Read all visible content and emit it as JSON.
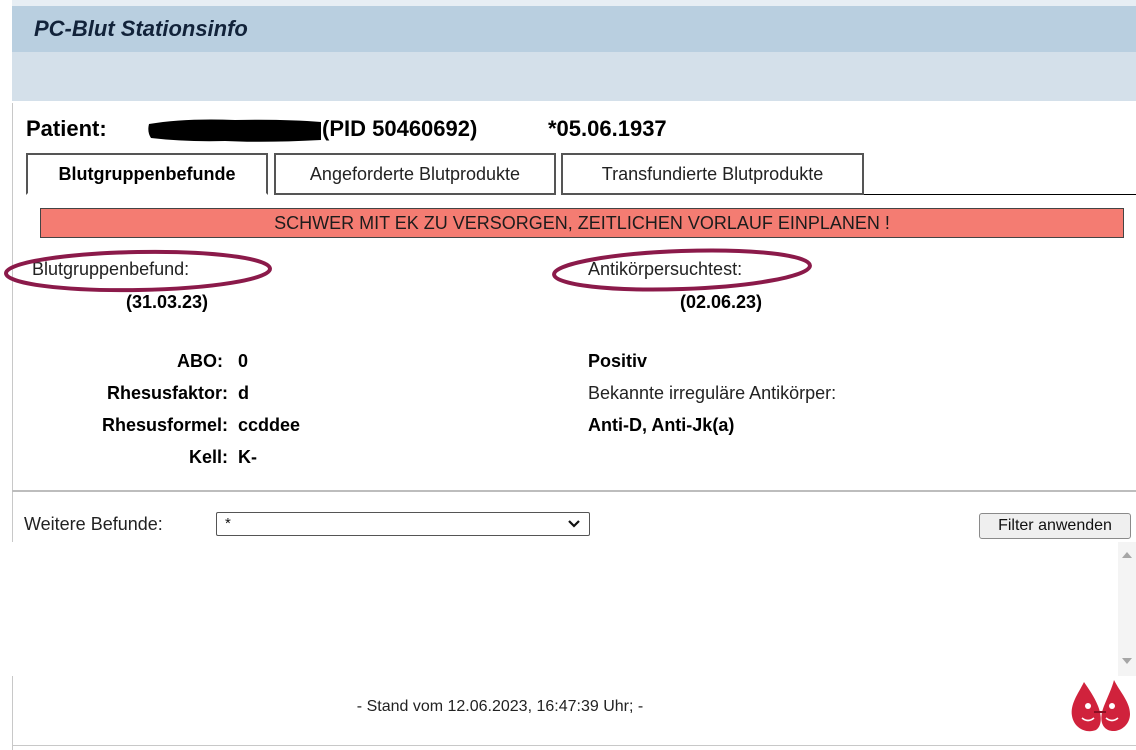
{
  "app": {
    "title": "PC-Blut Stationsinfo"
  },
  "patient": {
    "label": "Patient:",
    "pid": "(PID 50460692)",
    "birth_date": "*05.06.1937"
  },
  "tabs": [
    {
      "label": "Blutgruppenbefunde",
      "active": true
    },
    {
      "label": "Angeforderte Blutprodukte",
      "active": false
    },
    {
      "label": "Transfundierte Blutprodukte",
      "active": false
    }
  ],
  "warning": {
    "text": "SCHWER MIT EK ZU VERSORGEN, ZEITLICHEN VORLAUF EINPLANEN !",
    "color": "#f47c72"
  },
  "blood_group": {
    "heading": "Blutgruppenbefund:",
    "date": "(31.03.23)",
    "rows": [
      {
        "label": "ABO:",
        "value": "0"
      },
      {
        "label": "Rhesusfaktor:",
        "value": "d"
      },
      {
        "label": "Rhesusformel:",
        "value": "ccddee"
      },
      {
        "label": "Kell:",
        "value": "K-"
      }
    ]
  },
  "antibody_test": {
    "heading": "Antikörpersuchtest:",
    "date": "(02.06.23)",
    "result": "Positiv",
    "known_label": "Bekannte irreguläre Antikörper:",
    "known_value": "Anti-D, Anti-Jk(a)"
  },
  "filter": {
    "label": "Weitere Befunde:",
    "selected": "*",
    "button_label": "Filter anwenden"
  },
  "footer": {
    "stand": "- Stand vom 12.06.2023, 16:47:39 Uhr; -"
  },
  "colors": {
    "title_bar": "#b9cfe0",
    "sub_bar": "#d4e0ea",
    "annotation_ellipse": "#8b1a4a",
    "logo_red": "#d0223c"
  },
  "icons": {
    "dropdown": "chevron-down-icon",
    "logo": "blood-drop-mascot-logo"
  }
}
